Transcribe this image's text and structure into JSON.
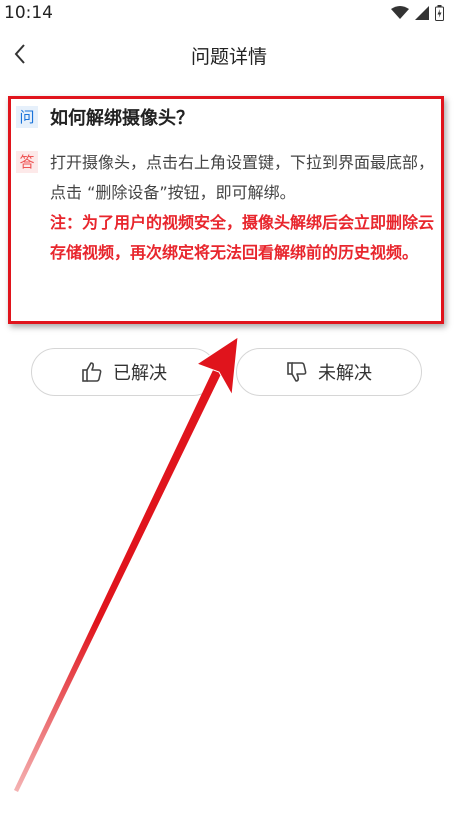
{
  "status_bar": {
    "time": "10:14"
  },
  "nav": {
    "title": "问题详情"
  },
  "qa": {
    "q_tag": "问",
    "question": "如何解绑摄像头？",
    "a_tag": "答",
    "answer": "打开摄像头，点击右上角设置键，下拉到界面最底部，点击 “删除设备”按钮，即可解绑。",
    "note": "注：为了用户的视频安全，摄像头解绑后会立即删除云存储视频，再次绑定将无法回看解绑前的历史视频。"
  },
  "feedback": {
    "resolved_label": "已解决",
    "unresolved_label": "未解决"
  },
  "colors": {
    "annotation_red": "#e0141c",
    "note_red": "#e8262d",
    "q_blue": "#1a73d9"
  }
}
